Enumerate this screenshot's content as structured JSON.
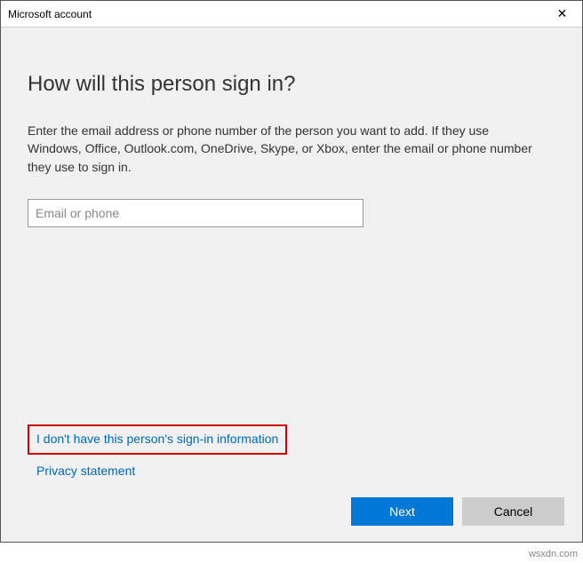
{
  "titlebar": {
    "title": "Microsoft account",
    "close_symbol": "✕"
  },
  "content": {
    "heading": "How will this person sign in?",
    "description": "Enter the email address or phone number of the person you want to add. If they use Windows, Office, Outlook.com, OneDrive, Skype, or Xbox, enter the email or phone number they use to sign in.",
    "email_placeholder": "Email or phone",
    "email_value": ""
  },
  "links": {
    "no_info": "I don't have this person's sign-in information",
    "privacy": "Privacy statement"
  },
  "buttons": {
    "next": "Next",
    "cancel": "Cancel"
  },
  "watermark": "wsxdn.com"
}
